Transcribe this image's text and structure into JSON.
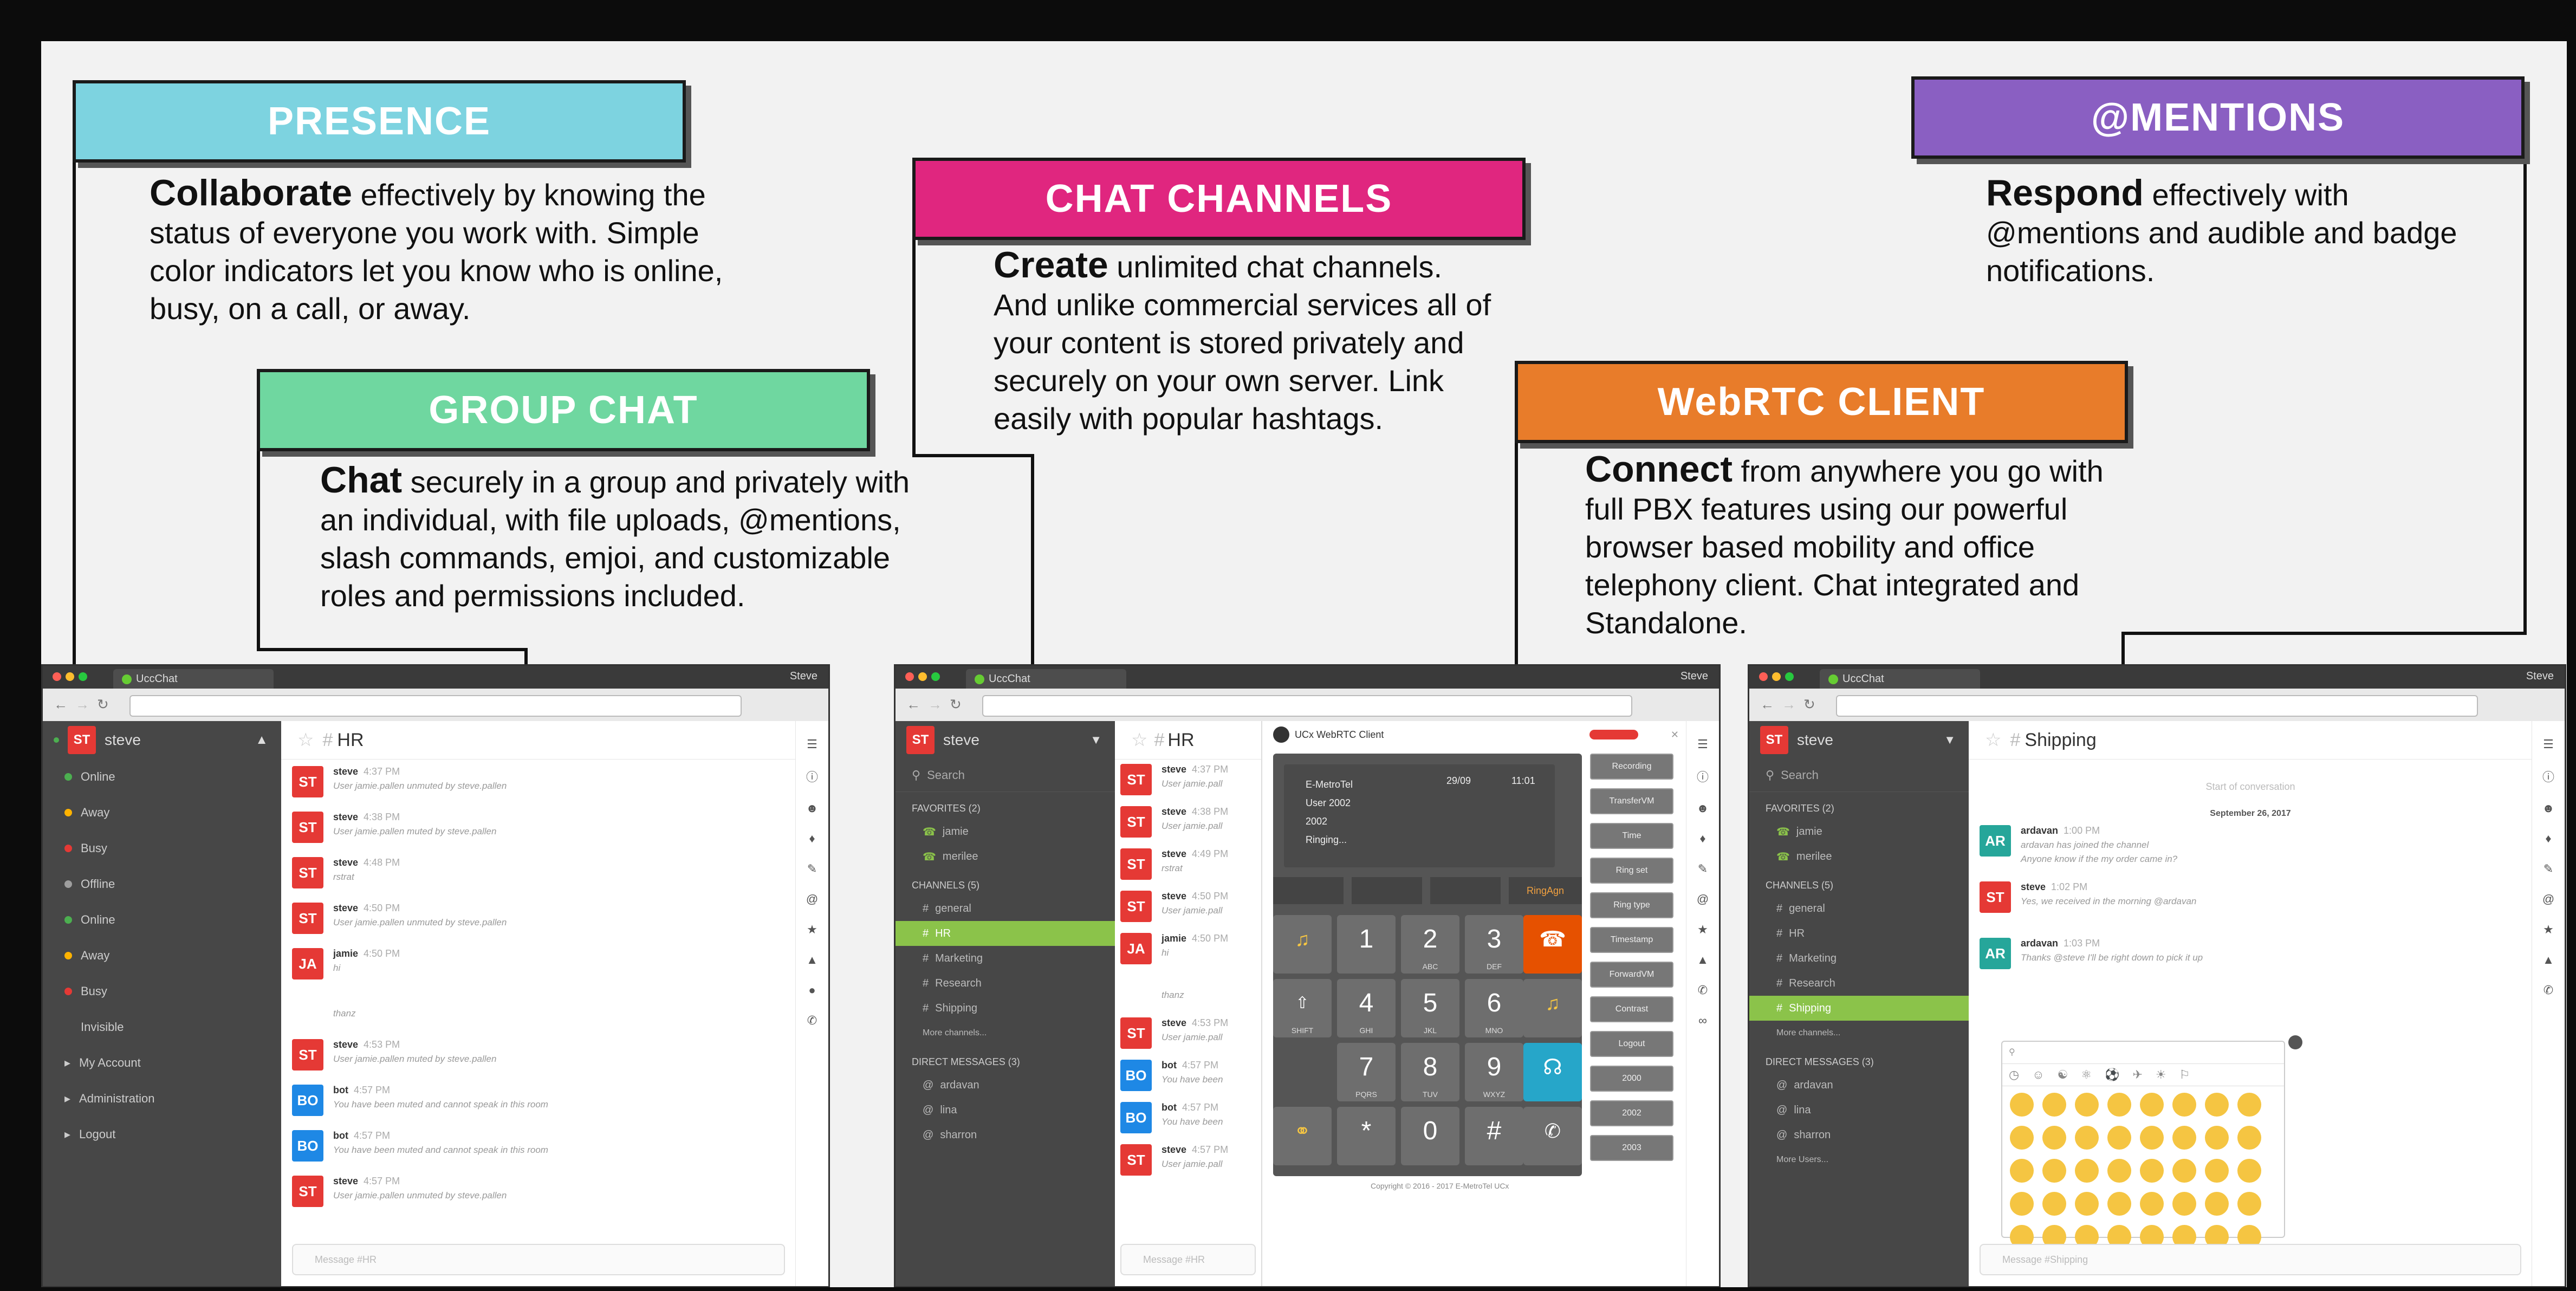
{
  "callouts": {
    "presence": {
      "title": "PRESENCE",
      "color": "#7dd3e0",
      "lead": "Collaborate",
      "body": " effectively by knowing the status of everyone you work with. Simple color indicators let you know who is online, busy, on a call, or away."
    },
    "group_chat": {
      "title": "GROUP CHAT",
      "color": "#6fd7a0",
      "lead": "Chat",
      "body": " securely in a group and privately with an individual, with file uploads, @mentions, slash commands, emjoi, and customizable roles and permissions included."
    },
    "chat_channels": {
      "title": "CHAT CHANNELS",
      "color": "#e0267f",
      "lead": "Create",
      "body": " unlimited chat channels. And unlike commercial services all of your content is stored privately and securely on your own server. Link easily with popular hashtags."
    },
    "webrtc": {
      "title": "WebRTC CLIENT",
      "color": "#e87c2a",
      "lead": "Connect",
      "body": " from anywhere you go with full PBX features using our powerful browser based mobility and office telephony client. Chat integrated and Standalone."
    },
    "mentions": {
      "title": "@MENTIONS",
      "color": "#8a5fc2",
      "lead": "Respond",
      "body": " effectively with @mentions and audible and badge notifications."
    }
  },
  "shot1": {
    "tab": "UccChat",
    "user": "Steve",
    "sidebar_user": "steve",
    "avatar": "ST",
    "status_items": [
      {
        "label": "Online",
        "color": "#4caf50"
      },
      {
        "label": "Away",
        "color": "#ffb300"
      },
      {
        "label": "Busy",
        "color": "#e53935"
      },
      {
        "label": "Offline",
        "color": "#9e9e9e"
      },
      {
        "label": "Online",
        "color": "#4caf50"
      },
      {
        "label": "Away",
        "color": "#ffb300"
      },
      {
        "label": "Busy",
        "color": "#e53935"
      },
      {
        "label": "Invisible",
        "color": ""
      }
    ],
    "menu_items": [
      "My Account",
      "Administration",
      "Logout"
    ],
    "room": "HR",
    "messages": [
      {
        "av": "ST",
        "color": "#e53935",
        "name": "steve",
        "time": "4:37 PM",
        "text": "User jamie.pallen unmuted by steve.pallen"
      },
      {
        "av": "ST",
        "color": "#e53935",
        "name": "steve",
        "time": "4:38 PM",
        "text": "User jamie.pallen muted by steve.pallen"
      },
      {
        "av": "ST",
        "color": "#e53935",
        "name": "steve",
        "time": "4:48 PM",
        "text": "rstrat"
      },
      {
        "av": "ST",
        "color": "#e53935",
        "name": "steve",
        "time": "4:50 PM",
        "text": "User jamie.pallen unmuted by steve.pallen"
      },
      {
        "av": "JA",
        "color": "#e53935",
        "name": "jamie",
        "time": "4:50 PM",
        "text": "hi"
      },
      {
        "av": "",
        "color": "",
        "name": "",
        "time": "",
        "text": "thanz"
      },
      {
        "av": "ST",
        "color": "#e53935",
        "name": "steve",
        "time": "4:53 PM",
        "text": "User jamie.pallen muted by steve.pallen"
      },
      {
        "av": "BO",
        "color": "#1e88e5",
        "name": "bot",
        "time": "4:57 PM",
        "text": "You have been muted and cannot speak in this room"
      },
      {
        "av": "BO",
        "color": "#1e88e5",
        "name": "bot",
        "time": "4:57 PM",
        "text": "You have been muted and cannot speak in this room"
      },
      {
        "av": "ST",
        "color": "#e53935",
        "name": "steve",
        "time": "4:57 PM",
        "text": "User jamie.pallen unmuted by steve.pallen"
      }
    ],
    "composer": "Message #HR"
  },
  "shot2": {
    "tab": "UccChat",
    "user": "Steve",
    "sidebar_user": "steve",
    "avatar": "ST",
    "search": "Search",
    "favorites_header": "FAVORITES (2)",
    "favorites": [
      "jamie",
      "merilee"
    ],
    "channels_header": "CHANNELS (5)",
    "channels": [
      "general",
      "HR",
      "Marketing",
      "Research",
      "Shipping"
    ],
    "more_channels": "More channels...",
    "dm_header": "DIRECT MESSAGES (3)",
    "dms": [
      "ardavan",
      "lina",
      "sharron"
    ],
    "room": "HR",
    "messages": [
      {
        "av": "ST",
        "color": "#e53935",
        "name": "steve",
        "time": "4:37 PM",
        "text": "User jamie.pall"
      },
      {
        "av": "ST",
        "color": "#e53935",
        "name": "steve",
        "time": "4:38 PM",
        "text": "User jamie.pall"
      },
      {
        "av": "ST",
        "color": "#e53935",
        "name": "steve",
        "time": "4:49 PM",
        "text": "rstrat"
      },
      {
        "av": "ST",
        "color": "#e53935",
        "name": "steve",
        "time": "4:50 PM",
        "text": "User jamie.pall"
      },
      {
        "av": "JA",
        "color": "#e53935",
        "name": "jamie",
        "time": "4:50 PM",
        "text": "hi"
      },
      {
        "av": "",
        "color": "",
        "name": "",
        "time": "",
        "text": "thanz"
      },
      {
        "av": "ST",
        "color": "#e53935",
        "name": "steve",
        "time": "4:53 PM",
        "text": "User jamie.pall"
      },
      {
        "av": "BO",
        "color": "#1e88e5",
        "name": "bot",
        "time": "4:57 PM",
        "text": "You have been"
      },
      {
        "av": "BO",
        "color": "#1e88e5",
        "name": "bot",
        "time": "4:57 PM",
        "text": "You have been"
      },
      {
        "av": "ST",
        "color": "#e53935",
        "name": "steve",
        "time": "4:57 PM",
        "text": "User jamie.pall"
      }
    ],
    "composer": "Message #HR",
    "webrtc_title": "UCx WebRTC Client",
    "display_lines": [
      "E-MetroTel",
      "User 2002",
      "2002",
      "Ringing..."
    ],
    "display_date": "29/09",
    "display_time": "11:01",
    "ringagn": "RingAgn",
    "keys": [
      {
        "d": "1",
        "s": ""
      },
      {
        "d": "2",
        "s": "ABC"
      },
      {
        "d": "3",
        "s": "DEF"
      },
      {
        "d": "4",
        "s": "GHI"
      },
      {
        "d": "5",
        "s": "JKL"
      },
      {
        "d": "6",
        "s": "MNO"
      },
      {
        "d": "7",
        "s": "PQRS"
      },
      {
        "d": "8",
        "s": "TUV"
      },
      {
        "d": "9",
        "s": "WXYZ"
      },
      {
        "d": "*",
        "s": ""
      },
      {
        "d": "0",
        "s": ""
      },
      {
        "d": "#",
        "s": ""
      }
    ],
    "shift": "SHIFT",
    "functions": [
      "Recording",
      "TransferVM",
      "Time",
      "Ring set",
      "Ring type",
      "Timestamp",
      "ForwardVM",
      "Contrast",
      "Logout",
      "2000",
      "2002",
      "2003"
    ],
    "copyright": "Copyright © 2016 - 2017 E-MetroTel UCx"
  },
  "shot3": {
    "tab": "UccChat",
    "user": "Steve",
    "sidebar_user": "steve",
    "avatar": "ST",
    "search": "Search",
    "favorites_header": "FAVORITES (2)",
    "favorites": [
      "jamie",
      "merilee"
    ],
    "channels_header": "CHANNELS (5)",
    "channels": [
      "general",
      "HR",
      "Marketing",
      "Research",
      "Shipping"
    ],
    "more_channels": "More channels...",
    "dm_header": "DIRECT MESSAGES (3)",
    "dms": [
      "ardavan",
      "lina",
      "sharron"
    ],
    "more_users": "More Users...",
    "room": "Shipping",
    "start": "Start of conversation",
    "date": "September 26, 2017",
    "messages": [
      {
        "av": "AR",
        "color": "#26a69a",
        "name": "ardavan",
        "time": "1:00 PM",
        "text": "ardavan has joined the channel",
        "text2": "Anyone know if the my order came in?"
      },
      {
        "av": "ST",
        "color": "#e53935",
        "name": "steve",
        "time": "1:02 PM",
        "text": "Yes, we received in the morning @ardavan",
        "text2": ""
      },
      {
        "av": "AR",
        "color": "#26a69a",
        "name": "ardavan",
        "time": "1:03 PM",
        "text": "Thanks @steve I'll be right down to pick it up",
        "text2": ""
      }
    ],
    "mention_tag": "@steve",
    "composer": "Message #Shipping"
  }
}
